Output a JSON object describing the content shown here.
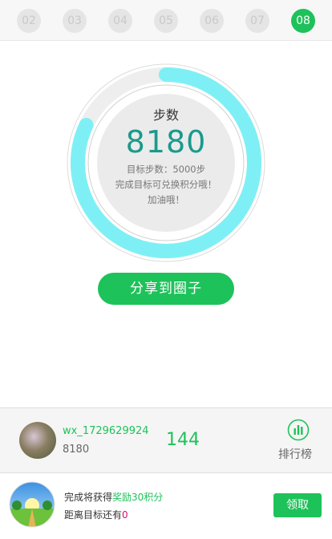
{
  "dates": [
    "02",
    "03",
    "04",
    "05",
    "06",
    "07",
    "08"
  ],
  "active_date": "08",
  "steps": {
    "label": "步数",
    "value": "8180",
    "goal_text": "目标步数：5000步",
    "hint_line1": "完成目标可兑换积分哦！",
    "hint_line2": "加油哦！",
    "progress_fraction": 0.82,
    "ring_color": "#7ef0f5",
    "track_color": "#eeeeee"
  },
  "share_button": "分享到圈子",
  "user": {
    "name": "wx_1729629924",
    "steps": "8180",
    "rank": "144",
    "rank_label": "排行榜",
    "rank_icon": "bar-chart-icon"
  },
  "reward": {
    "line1_prefix": "完成将获得",
    "line1_highlight": "奖励30积分",
    "line2_prefix": "距离目标还有",
    "line2_value": "0",
    "claim_button": "领取",
    "image_icon": "landscape-icon"
  },
  "colors": {
    "accent": "#1ec25a",
    "steps_number": "#1a9a8c",
    "highlight_red": "#d0106a"
  }
}
